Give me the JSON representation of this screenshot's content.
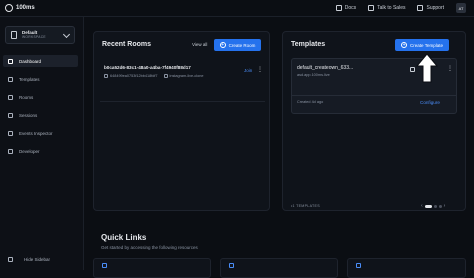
{
  "app": {
    "logo_text": "100ms"
  },
  "topbar": {
    "links": [
      {
        "label": "Docs",
        "icon": "docs-icon"
      },
      {
        "label": "Talk to Sales",
        "icon": "phone-icon"
      },
      {
        "label": "Support",
        "icon": "help-icon"
      }
    ],
    "avatar_initials": "AT"
  },
  "sidebar": {
    "workspace": {
      "name": "Default",
      "subtitle": "WORKSPACE"
    },
    "items": [
      {
        "label": "Dashboard",
        "icon": "home-icon",
        "active": true
      },
      {
        "label": "Templates",
        "icon": "template-icon",
        "active": false
      },
      {
        "label": "Rooms",
        "icon": "rooms-icon",
        "active": false
      },
      {
        "label": "Sessions",
        "icon": "sessions-icon",
        "active": false
      },
      {
        "label": "Events Inspector",
        "icon": "inspector-icon",
        "active": false
      },
      {
        "label": "Developer",
        "icon": "code-icon",
        "active": false
      }
    ],
    "hide_label": "Hide Sidebar"
  },
  "recent_rooms": {
    "title": "Recent Rooms",
    "view_all": "View all",
    "create_button": "Create Room",
    "rooms": [
      {
        "id": "b0ca52d6-83c1-48a0-a4ba-7f4940f88d17",
        "code": "648499ea0753f12bb418fdf7",
        "template": "instagram-live-clone",
        "action": "Join"
      }
    ]
  },
  "templates": {
    "title": "Templates",
    "create_button": "Create Template",
    "items": [
      {
        "name": "default_createown_633...",
        "subdomain": "asd.app.100ms.live",
        "created": "Created 4d ago",
        "action": "Configure"
      }
    ],
    "count_label": "•1 TEMPLATES"
  },
  "quick_links": {
    "title": "Quick Links",
    "subtitle": "Get started by accessing the following resources"
  },
  "colors": {
    "accent": "#2572ed",
    "link": "#4a8df8",
    "background": "#0b0e13"
  }
}
